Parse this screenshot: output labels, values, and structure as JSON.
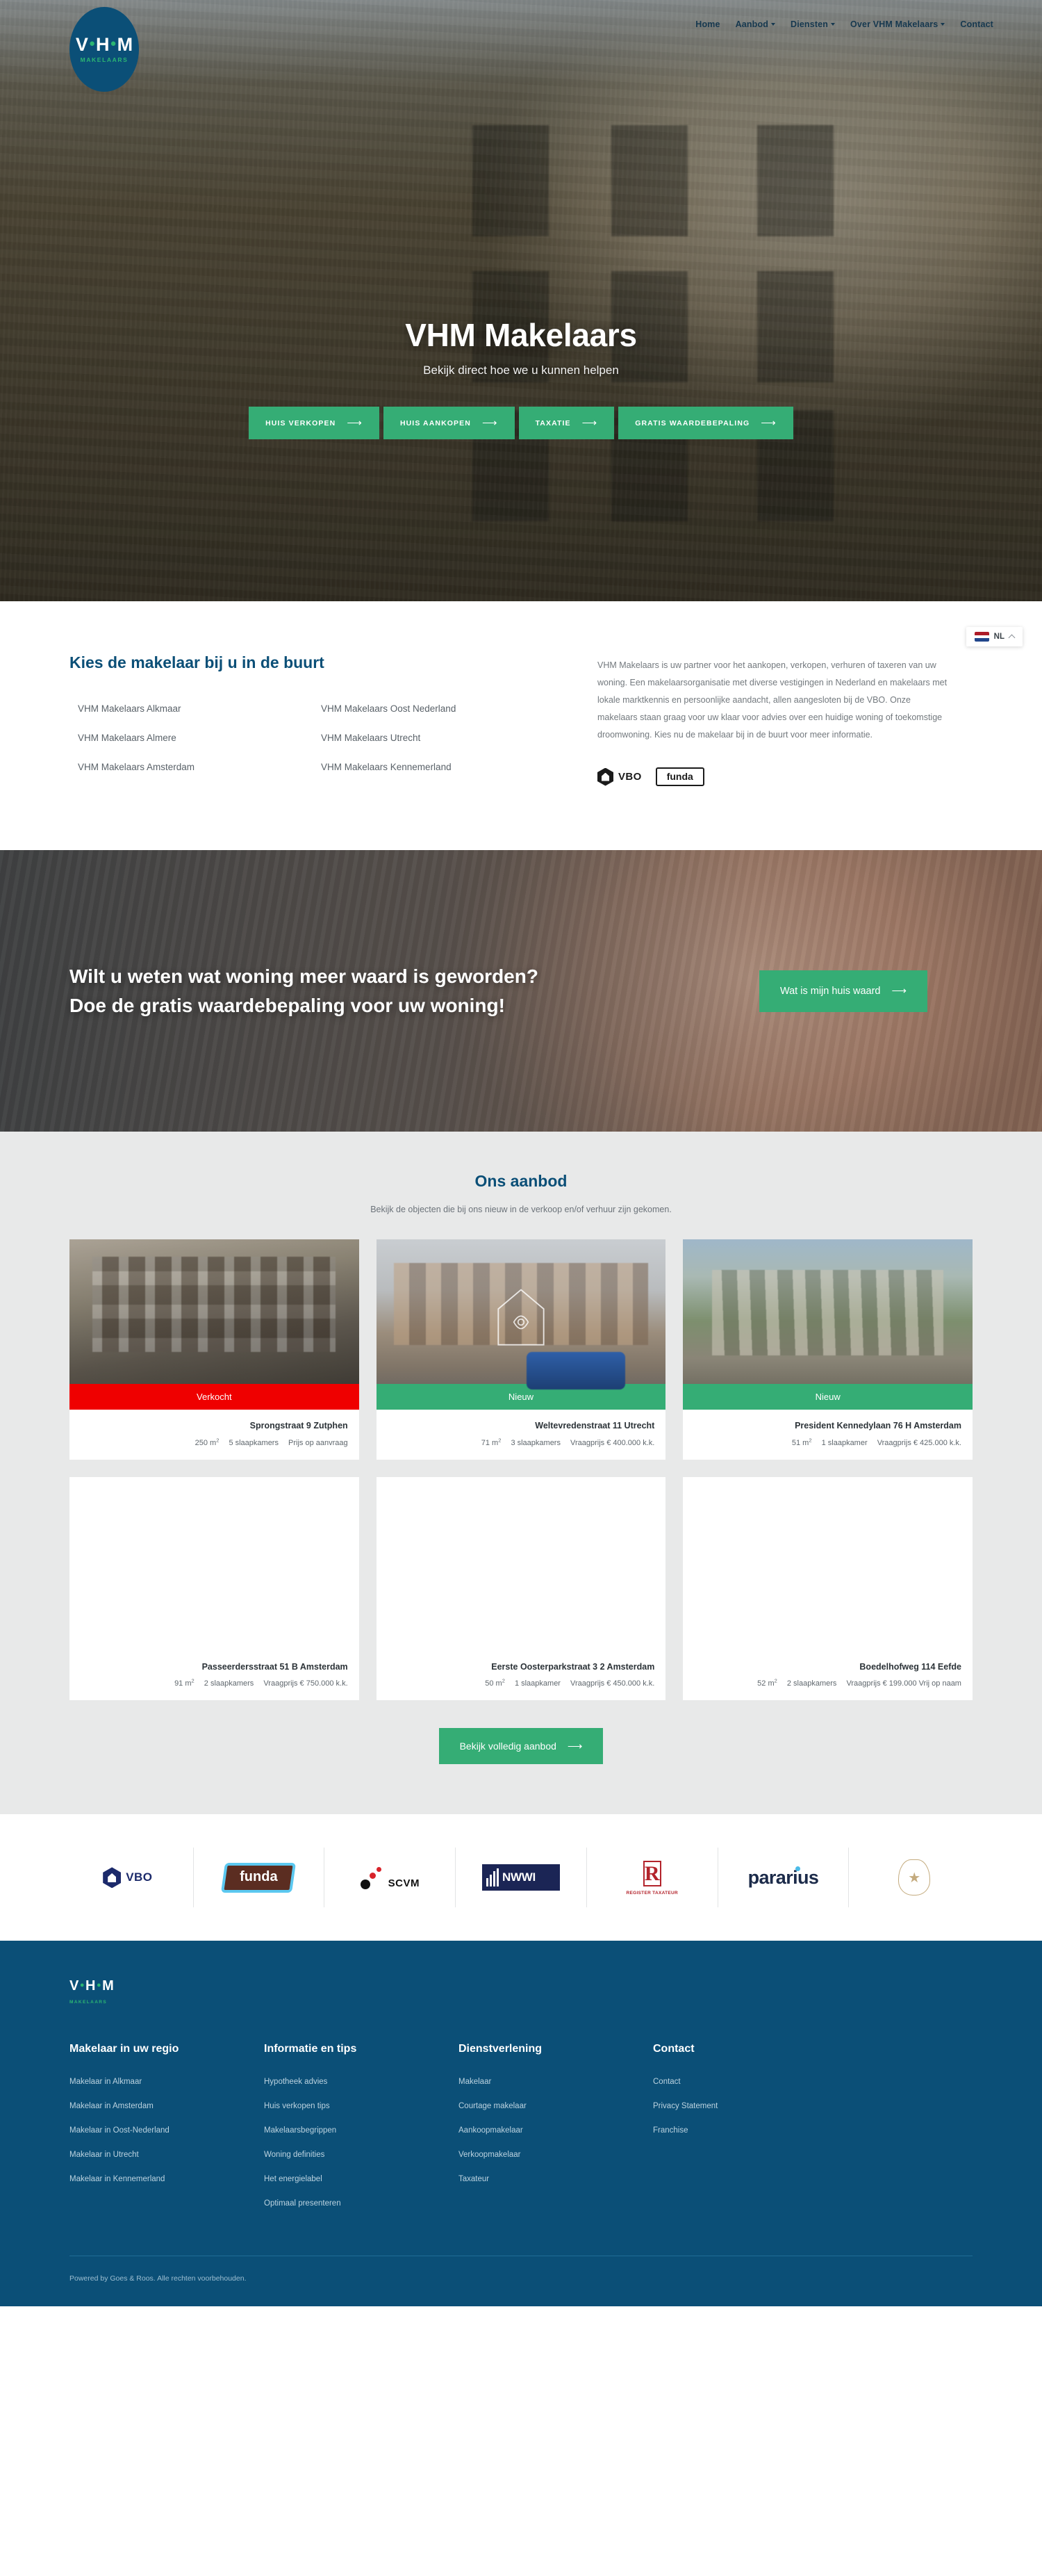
{
  "brand": {
    "logo_initials": "VHM",
    "logo_sub": "MAKELAARS"
  },
  "nav": {
    "items": [
      {
        "label": "Home",
        "has_dropdown": false
      },
      {
        "label": "Aanbod",
        "has_dropdown": true
      },
      {
        "label": "Diensten",
        "has_dropdown": true
      },
      {
        "label": "Over VHM Makelaars",
        "has_dropdown": true
      },
      {
        "label": "Contact",
        "has_dropdown": false
      }
    ]
  },
  "hero": {
    "title": "VHM Makelaars",
    "subtitle": "Bekijk direct hoe we u kunnen helpen",
    "ctas": [
      {
        "label": "HUIS VERKOPEN"
      },
      {
        "label": "HUIS AANKOPEN"
      },
      {
        "label": "TAXATIE"
      },
      {
        "label": "GRATIS WAARDEBEPALING"
      }
    ],
    "arrow": "⟶"
  },
  "regio": {
    "title": "Kies de makelaar bij u in de buurt",
    "col_left": [
      "VHM Makelaars Alkmaar",
      "VHM Makelaars Almere",
      "VHM Makelaars Amsterdam"
    ],
    "col_right": [
      "VHM Makelaars Oost Nederland",
      "VHM Makelaars Utrecht",
      "VHM Makelaars Kennemerland"
    ],
    "paragraph": "VHM Makelaars is uw partner voor het aankopen, verkopen, verhuren of taxeren van uw woning. Een makelaarsorganisatie met diverse vestigingen in Nederland en makelaars met lokale marktkennis en persoonlijke aandacht, allen aangesloten bij de VBO. Onze makelaars staan graag voor uw klaar voor advies over een huidige woning of toekomstige droomwoning. Kies nu de makelaar bij in de buurt voor meer informatie.",
    "badges": [
      {
        "name": "VBO",
        "label": "VBO"
      },
      {
        "name": "funda",
        "label": "funda"
      }
    ]
  },
  "language_switcher": {
    "code": "NL",
    "flag": "nl-flag",
    "chevron": "chevron-up"
  },
  "waarde": {
    "heading": "Wilt u weten wat woning meer waard is geworden? Doe de gratis waardebepaling voor uw woning!",
    "button_label": "Wat is mijn huis waard",
    "arrow": "⟶",
    "accent": "#35ad75"
  },
  "aanbod": {
    "title": "Ons aanbod",
    "subtitle": "Bekijk de objecten die bij ons nieuw in de verkoop en/of verhuur zijn gekomen.",
    "button_label": "Bekijk volledig aanbod",
    "arrow": "⟶",
    "status_colors": {
      "verkocht": "#ef0000",
      "nieuw": "#35ad75"
    },
    "cards": [
      {
        "status": "Verkocht",
        "status_type": "verkocht",
        "address": "Sprongstraat 9 Zutphen",
        "area": "250 m",
        "area_sup": "2",
        "bedrooms": "5 slaapkamers",
        "price": "Prijs op aanvraag",
        "has_photo": true
      },
      {
        "status": "Nieuw",
        "status_type": "nieuw",
        "address": "Weltevredenstraat 11 Utrecht",
        "area": "71 m",
        "area_sup": "2",
        "bedrooms": "3 slaapkamers",
        "price": "Vraagprijs € 400.000 k.k.",
        "has_photo": true
      },
      {
        "status": "Nieuw",
        "status_type": "nieuw",
        "address": "President Kennedylaan 76 H Amsterdam",
        "area": "51 m",
        "area_sup": "2",
        "bedrooms": "1 slaapkamer",
        "price": "Vraagprijs € 425.000 k.k.",
        "has_photo": true
      },
      {
        "status": "",
        "status_type": "none",
        "address": "Passeerdersstraat 51 B Amsterdam",
        "area": "91 m",
        "area_sup": "2",
        "bedrooms": "2 slaapkamers",
        "price": "Vraagprijs € 750.000 k.k.",
        "has_photo": false
      },
      {
        "status": "",
        "status_type": "none",
        "address": "Eerste Oosterparkstraat 3 2 Amsterdam",
        "area": "50 m",
        "area_sup": "2",
        "bedrooms": "1 slaapkamer",
        "price": "Vraagprijs € 450.000 k.k.",
        "has_photo": false
      },
      {
        "status": "",
        "status_type": "none",
        "address": "Boedelhofweg 114 Eefde",
        "area": "52 m",
        "area_sup": "2",
        "bedrooms": "2 slaapkamers",
        "price": "Vraagprijs € 199.000 Vrij op naam",
        "has_photo": false
      }
    ]
  },
  "partners": [
    {
      "name": "vbo-logo",
      "label": "VBO"
    },
    {
      "name": "funda-logo",
      "label": "funda"
    },
    {
      "name": "scvm-logo",
      "label": "SCVM"
    },
    {
      "name": "nwwi-logo",
      "label": "NWWI"
    },
    {
      "name": "register-taxateur-logo",
      "label": "R",
      "sub": "REGISTER TAXATEUR"
    },
    {
      "name": "pararius-logo",
      "label": "pararius"
    },
    {
      "name": "vhm-seal-logo",
      "label": ""
    }
  ],
  "footer": {
    "logo_initials": "VHM",
    "logo_sub": "MAKELAARS",
    "columns": [
      {
        "heading": "Makelaar in uw regio",
        "links": [
          "Makelaar in Alkmaar",
          "Makelaar in Amsterdam",
          "Makelaar in Oost-Nederland",
          "Makelaar in Utrecht",
          "Makelaar in Kennemerland"
        ]
      },
      {
        "heading": "Informatie en tips",
        "links": [
          "Hypotheek advies",
          "Huis verkopen tips",
          "Makelaarsbegrippen",
          "Woning definities",
          "Het energielabel",
          "Optimaal presenteren"
        ]
      },
      {
        "heading": "Dienstverlening",
        "links": [
          "Makelaar",
          "Courtage makelaar",
          "Aankoopmakelaar",
          "Verkoopmakelaar",
          "Taxateur"
        ]
      },
      {
        "heading": "Contact",
        "links": [
          "Contact",
          "Privacy Statement",
          "Franchise"
        ]
      }
    ],
    "copyright": "Powered by Goes & Roos. Alle rechten voorbehouden."
  },
  "colors": {
    "brand_blue": "#0b4f77",
    "brand_green": "#35ad75",
    "sold_red": "#ef0000",
    "light_grey": "#e8e9e9"
  }
}
